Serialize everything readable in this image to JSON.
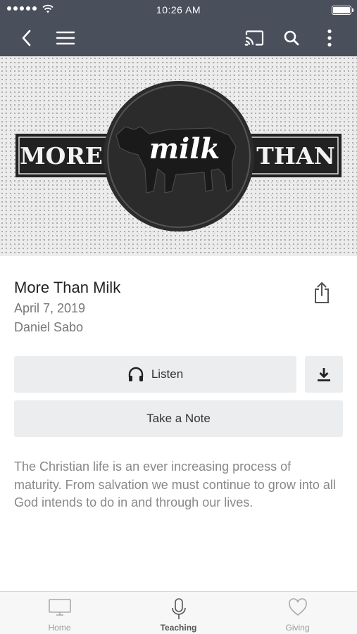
{
  "status_bar": {
    "time": "10:26 AM",
    "signal_icon": "signal-dots-icon",
    "wifi_icon": "wifi-icon",
    "battery_icon": "battery-icon"
  },
  "nav": {
    "back_icon": "chevron-left-icon",
    "menu_icon": "hamburger-menu-icon",
    "cast_icon": "cast-icon",
    "search_icon": "search-icon",
    "more_icon": "more-vertical-icon",
    "bar_color": "#4a4f5c"
  },
  "hero": {
    "left_word": "MORE",
    "center_word": "milk",
    "right_word": "THAN"
  },
  "sermon": {
    "title": "More Than Milk",
    "date": "April 7, 2019",
    "speaker": "Daniel Sabo",
    "share_icon": "share-icon"
  },
  "actions": {
    "listen_label": "Listen",
    "listen_icon": "headphones-icon",
    "download_icon": "download-icon",
    "note_label": "Take a Note"
  },
  "description": "The Christian life is an ever increasing process of maturity. From salvation we must continue to grow into all God intends to do in and through our lives.",
  "tabs": [
    {
      "label": "Home",
      "icon": "monitor-icon",
      "active": false
    },
    {
      "label": "Teaching",
      "icon": "microphone-icon",
      "active": true
    },
    {
      "label": "Giving",
      "icon": "heart-icon",
      "active": false
    }
  ]
}
